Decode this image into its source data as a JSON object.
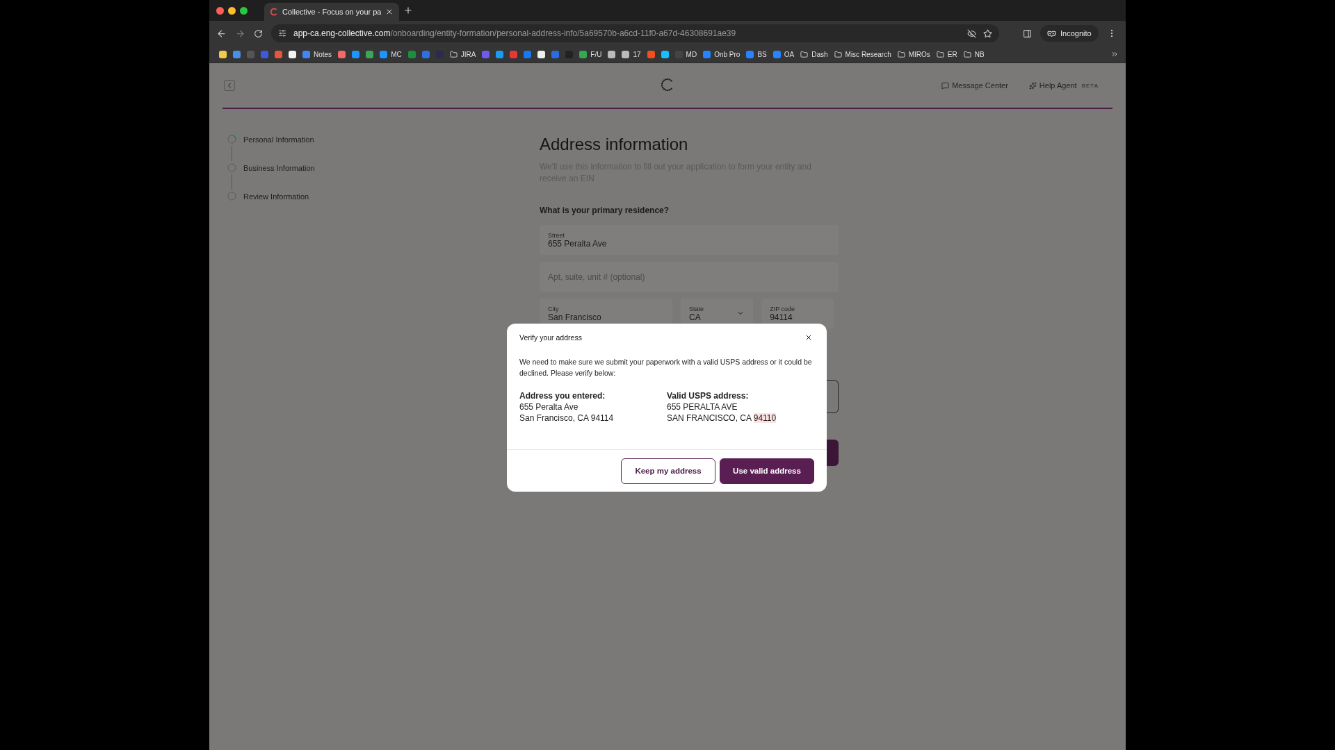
{
  "browser": {
    "tab": {
      "title": "Collective - Focus on your pa"
    },
    "address": {
      "host": "app-ca.eng-collective.com",
      "path": "/onboarding/entity-formation/personal-address-info/5a69570b-a6cd-11f0-a67d-46308691ae39"
    },
    "profile": "Incognito",
    "bookmarks": [
      {
        "kind": "app",
        "color": "#f2c94c"
      },
      {
        "kind": "app",
        "color": "#4a8fe7"
      },
      {
        "kind": "app",
        "color": "#555555"
      },
      {
        "kind": "app",
        "color": "#3b5bdb"
      },
      {
        "kind": "app",
        "color": "#e8553c"
      },
      {
        "kind": "app",
        "color": "#f2f2f2"
      },
      {
        "kind": "app",
        "color": "#4285f4",
        "label": "Notes"
      },
      {
        "kind": "app",
        "color": "#f06a6a"
      },
      {
        "kind": "app",
        "color": "#1b96ff"
      },
      {
        "kind": "app",
        "color": "#3aa757"
      },
      {
        "kind": "app",
        "color": "#1b96ff",
        "label": "MC"
      },
      {
        "kind": "app",
        "color": "#1e8e3e"
      },
      {
        "kind": "app",
        "color": "#2f6fe4"
      },
      {
        "kind": "app",
        "color": "#2b2b4f"
      },
      {
        "kind": "folder",
        "label": "JIRA"
      },
      {
        "kind": "app",
        "color": "#6c5ce7"
      },
      {
        "kind": "app",
        "color": "#1a9bf0"
      },
      {
        "kind": "app",
        "color": "#e53935"
      },
      {
        "kind": "app",
        "color": "#1877f2"
      },
      {
        "kind": "app",
        "color": "#eeeeee"
      },
      {
        "kind": "app",
        "color": "#2d6cdf"
      },
      {
        "kind": "app",
        "color": "#222222"
      },
      {
        "kind": "app",
        "color": "#34a853",
        "label": "F/U"
      },
      {
        "kind": "app",
        "color": "#bbbbbb"
      },
      {
        "kind": "app",
        "color": "#bbbbbb",
        "label": "17"
      },
      {
        "kind": "app",
        "color": "#f24e1e"
      },
      {
        "kind": "app",
        "color": "#18bfff"
      },
      {
        "kind": "app",
        "color": "#444444",
        "label": "MD"
      },
      {
        "kind": "app",
        "color": "#2684ff",
        "label": "Onb Pro"
      },
      {
        "kind": "app",
        "color": "#2684ff",
        "label": "BS"
      },
      {
        "kind": "app",
        "color": "#2684ff",
        "label": "OA"
      },
      {
        "kind": "folder",
        "label": "Dash"
      },
      {
        "kind": "folder",
        "label": "Misc Research"
      },
      {
        "kind": "folder",
        "label": "MIROs"
      },
      {
        "kind": "folder",
        "label": "ER"
      },
      {
        "kind": "folder",
        "label": "NB"
      }
    ]
  },
  "header": {
    "links": [
      {
        "kind": "messages",
        "label": "Message Center"
      },
      {
        "kind": "agent",
        "label": "Help Agent",
        "badge": "BETA"
      }
    ]
  },
  "steps": [
    {
      "label": "Personal Information",
      "current": true
    },
    {
      "label": "Business Information",
      "current": false
    },
    {
      "label": "Review Information",
      "current": false
    }
  ],
  "form": {
    "title": "Address information",
    "subtitle": "We'll use this information to fill out your application to form your entity and receive an EIN",
    "question": "What is your primary residence?",
    "rows": [
      [
        {
          "kind": "text",
          "label": "Street",
          "value": "655 Peralta Ave"
        }
      ],
      [
        {
          "kind": "text",
          "placeholder": "Apt, suite, unit # (optional)"
        }
      ],
      [
        {
          "kind": "text",
          "label": "City",
          "value": "San Francisco"
        },
        {
          "kind": "select",
          "label": "State",
          "value": "CA"
        },
        {
          "kind": "text",
          "label": "ZIP code",
          "value": "94114"
        }
      ]
    ]
  },
  "dialog": {
    "title": "Verify your address",
    "message": "We need to make sure we submit your paperwork with a valid USPS address or it could be declined. Please verify below:",
    "entered": {
      "heading": "Address you entered:",
      "line1": "655 Peralta Ave",
      "line2": "San Francisco, CA 94114"
    },
    "valid": {
      "heading": "Valid USPS address:",
      "line1": "655 PERALTA AVE",
      "line2": "SAN FRANCISCO, CA",
      "zip": "94110",
      "zip_changed": true
    },
    "buttons": [
      {
        "kind": "secondary",
        "label": "Keep my address"
      },
      {
        "kind": "primary",
        "label": "Use valid address"
      }
    ]
  }
}
